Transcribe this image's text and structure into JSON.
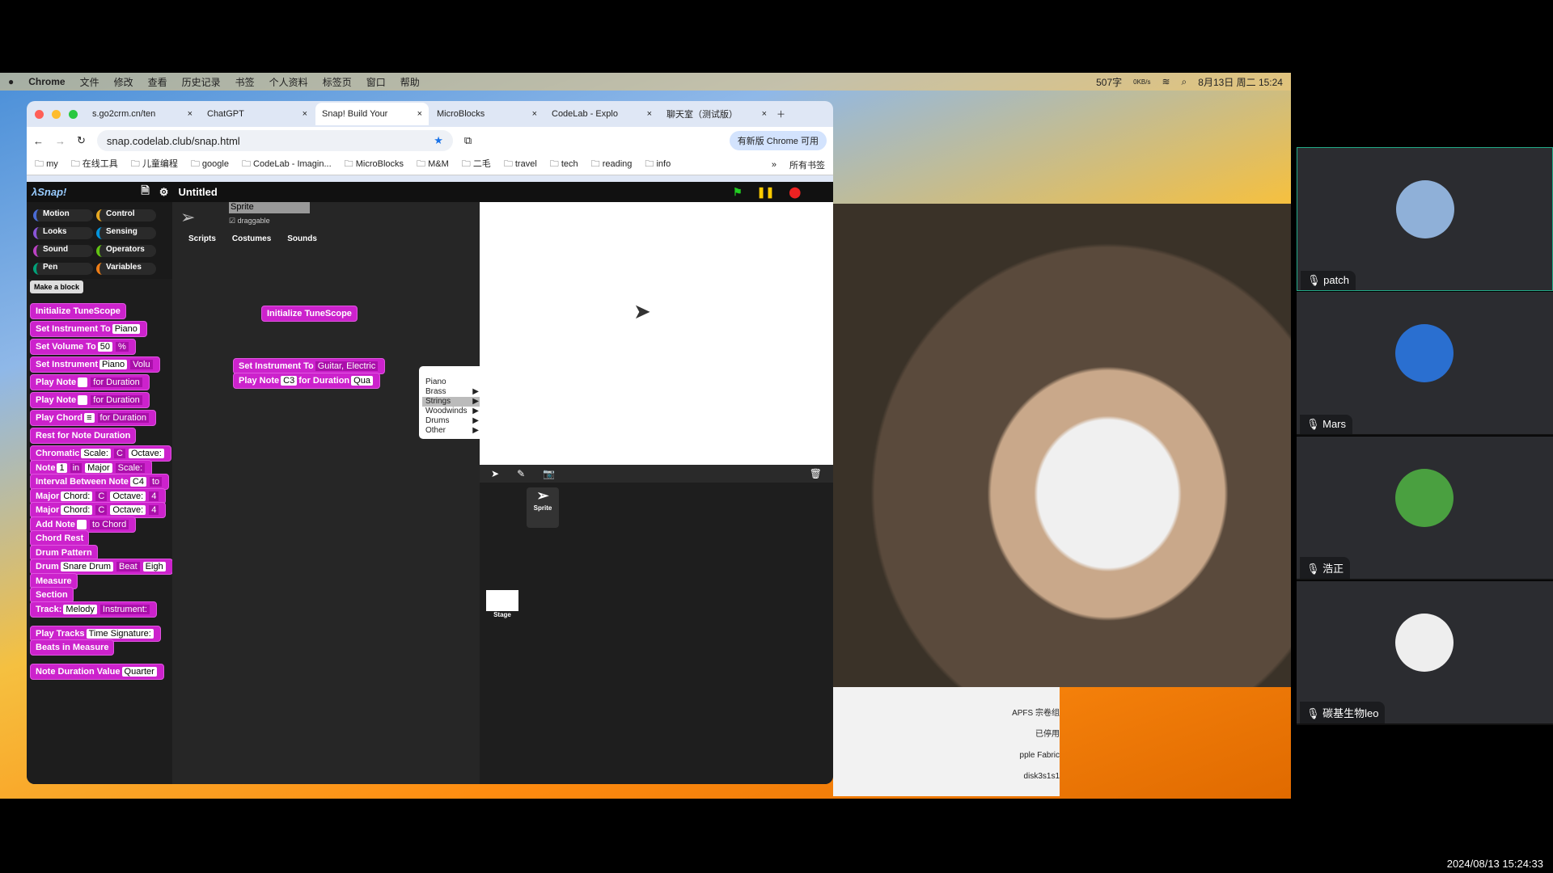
{
  "menubar": {
    "app": "Chrome",
    "items": [
      "文件",
      "修改",
      "查看",
      "历史记录",
      "书签",
      "个人资料",
      "标签页",
      "窗口",
      "帮助"
    ],
    "word_count": "507字",
    "net": "0KB/s",
    "clock": "8月13日 周二 15:24"
  },
  "tabs": [
    {
      "label": "s.go2crm.cn/ten"
    },
    {
      "label": "ChatGPT"
    },
    {
      "label": "Snap! Build Your"
    },
    {
      "label": "MicroBlocks"
    },
    {
      "label": "CodeLab - Explo"
    },
    {
      "label": "聊天室（测试版）"
    }
  ],
  "address": {
    "url": "snap.codelab.club/snap.html",
    "update_button": "有新版 Chrome 可用"
  },
  "bookmarks": [
    "my",
    "在线工具",
    "儿童编程",
    "google",
    "CodeLab - Imagin...",
    "MicroBlocks",
    "M&M",
    "二毛",
    "travel",
    "tech",
    "reading",
    "info"
  ],
  "bookmarks_more": "»",
  "all_bookmarks": "所有书签",
  "snap": {
    "title": "Untitled",
    "categories": [
      "Motion",
      "Control",
      "Looks",
      "Sensing",
      "Sound",
      "Operators",
      "Pen",
      "Variables"
    ],
    "category_colors": [
      "#4a6cd4",
      "#e6a822",
      "#8a55d7",
      "#0494dc",
      "#bb42c3",
      "#62c213",
      "#00a178",
      "#ee7d16"
    ],
    "selected_category": "Music",
    "make_block": "Make a block",
    "palette": [
      "Initialize TuneScope",
      "Set Instrument To|Piano",
      "Set Volume To|50|%",
      "Set Instrument|Piano|Volu",
      "Play Note||for Duration",
      "Play Note||for Duration",
      "Play Chord|≡|for Duration",
      "Rest for Note Duration",
      "Chromatic|Scale:|C|Octave:",
      "Note|1|in|Major|Scale:",
      "Interval Between Note|C4|to",
      "Major|Chord:|C|Octave:|4",
      "Major|Chord:|C|Octave:|4",
      "Add Note||to Chord",
      "Chord Rest",
      "Drum Pattern",
      "Drum|Snare Drum|Beat|Eigh",
      "Measure",
      "Section",
      "Track:|Melody|Instrument:",
      "Play Tracks|Time Signature:",
      "Beats in Measure",
      "Note Duration Value|Quarter"
    ],
    "sprite_name": "Sprite",
    "draggable": "draggable",
    "tabs": [
      "Scripts",
      "Costumes",
      "Sounds"
    ],
    "script_blocks": {
      "init": "Initialize TuneScope",
      "set_instr": "Set Instrument To",
      "set_instr_val": "Guitar, Electric",
      "play_note": "Play Note",
      "note_val": "C3",
      "for_duration": "for Duration",
      "dur_val": "Qua"
    },
    "menu": [
      "Piano",
      "Brass",
      "Strings",
      "Woodwinds",
      "Drums",
      "Other"
    ],
    "menu_highlight": "Strings",
    "corral": {
      "sprite": "Sprite",
      "stage": "Stage"
    }
  },
  "participants": [
    {
      "name": "patch",
      "color": "#8fb0d8"
    },
    {
      "name": "Mars",
      "color": "#2a6fd0"
    },
    {
      "name": "浩正",
      "color": "#4aa040"
    },
    {
      "name": "碳基生物leo",
      "color": "#eeeeee"
    }
  ],
  "bg_window": [
    "APFS 宗卷组",
    "已停用",
    "pple Fabric",
    "disk3s1s1"
  ],
  "timestamp": "2024/08/13 15:24:33"
}
